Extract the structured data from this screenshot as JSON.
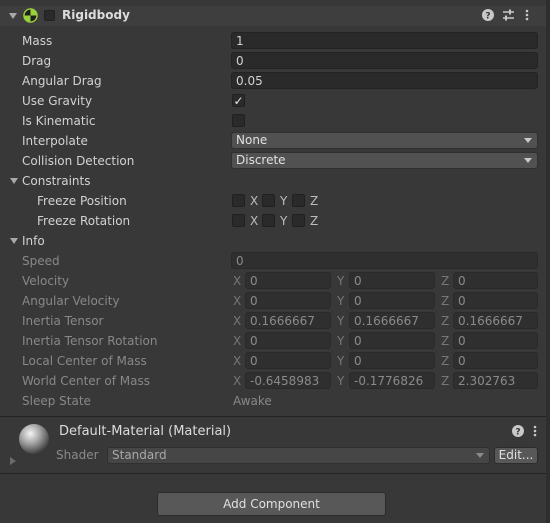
{
  "rigidbody": {
    "title": "Rigidbody",
    "mass": {
      "label": "Mass",
      "value": "1"
    },
    "drag": {
      "label": "Drag",
      "value": "0"
    },
    "angular_drag": {
      "label": "Angular Drag",
      "value": "0.05"
    },
    "use_gravity": {
      "label": "Use Gravity",
      "checked": true,
      "mark": "✓"
    },
    "is_kinematic": {
      "label": "Is Kinematic",
      "checked": false
    },
    "interpolate": {
      "label": "Interpolate",
      "value": "None"
    },
    "collision_detection": {
      "label": "Collision Detection",
      "value": "Discrete"
    }
  },
  "constraints": {
    "label": "Constraints",
    "freeze_position": {
      "label": "Freeze Position",
      "x": "X",
      "y": "Y",
      "z": "Z"
    },
    "freeze_rotation": {
      "label": "Freeze Rotation",
      "x": "X",
      "y": "Y",
      "z": "Z"
    }
  },
  "info": {
    "label": "Info",
    "speed": {
      "label": "Speed",
      "value": "0"
    },
    "velocity": {
      "label": "Velocity",
      "x": "0",
      "y": "0",
      "z": "0"
    },
    "angular_velocity": {
      "label": "Angular Velocity",
      "x": "0",
      "y": "0",
      "z": "0"
    },
    "inertia_tensor": {
      "label": "Inertia Tensor",
      "x": "0.1666667",
      "y": "0.1666667",
      "z": "0.1666667"
    },
    "inertia_tensor_rotation": {
      "label": "Inertia Tensor Rotation",
      "x": "0",
      "y": "0",
      "z": "0"
    },
    "local_center_of_mass": {
      "label": "Local Center of Mass",
      "x": "0",
      "y": "0",
      "z": "0"
    },
    "world_center_of_mass": {
      "label": "World Center of Mass",
      "x": "-0.6458983",
      "y": "-0.1776826",
      "z": "2.302763"
    },
    "sleep_state": {
      "label": "Sleep State",
      "value": "Awake"
    },
    "axis_x": "X",
    "axis_y": "Y",
    "axis_z": "Z"
  },
  "material": {
    "title": "Default-Material (Material)",
    "shader_label": "Shader",
    "shader_value": "Standard",
    "edit_label": "Edit..."
  },
  "footer": {
    "add_component_label": "Add Component"
  },
  "icons": {
    "component": "rigidbody-icon",
    "help": "help-icon",
    "presets": "presets-icon",
    "menu": "kebab-menu-icon"
  },
  "colors": {
    "accent_green": "#9bd23c",
    "background": "#383838",
    "field": "#2a2a2a"
  }
}
